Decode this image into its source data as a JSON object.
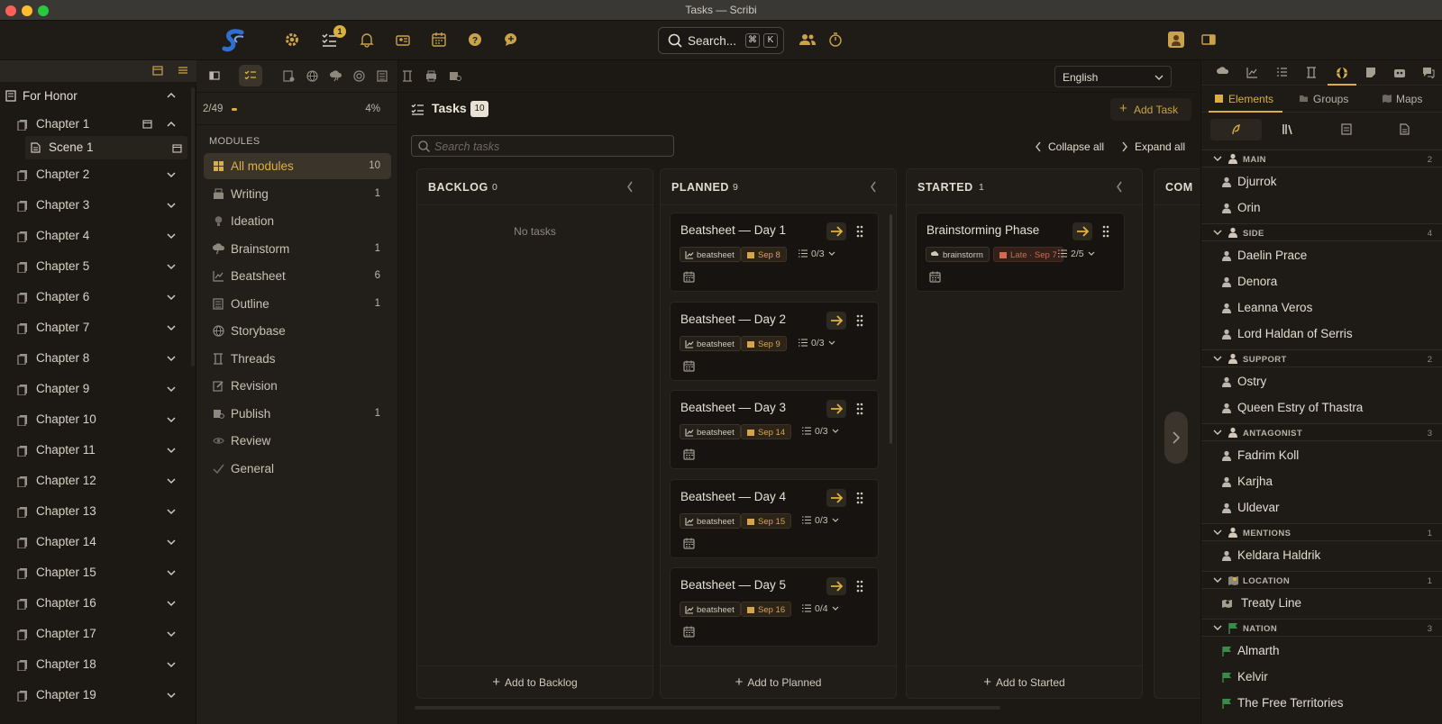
{
  "window": {
    "title": "Tasks — Scribi"
  },
  "toolbar": {
    "icons": [
      "gear-icon",
      "tasks-icon",
      "bell-icon",
      "people-card-icon",
      "calendar-icon",
      "help-icon",
      "chat-icon",
      "users-icon",
      "timer-icon",
      "avatar-icon",
      "panel-icon"
    ],
    "tasks_badge": "1",
    "search_label": "Search...",
    "search_kbd_1": "⌘",
    "search_kbd_2": "K",
    "accent": "#c9a24a"
  },
  "project": {
    "title": "For Honor",
    "chapters": [
      "Chapter 1",
      "Chapter 2",
      "Chapter 3",
      "Chapter 4",
      "Chapter 5",
      "Chapter 6",
      "Chapter 7",
      "Chapter 8",
      "Chapter 9",
      "Chapter 10",
      "Chapter 11",
      "Chapter 12",
      "Chapter 13",
      "Chapter 14",
      "Chapter 15",
      "Chapter 16",
      "Chapter 17",
      "Chapter 18",
      "Chapter 19"
    ],
    "scene": "Scene 1"
  },
  "progress": {
    "count": "2/49",
    "percent": "4%",
    "fraction": 0.04
  },
  "modules": {
    "heading": "MODULES",
    "items": [
      {
        "label": "All modules",
        "count": "10",
        "icon": "grid-icon"
      },
      {
        "label": "Writing",
        "count": "1",
        "icon": "typewriter-icon"
      },
      {
        "label": "Ideation",
        "count": "",
        "icon": "bulb-icon"
      },
      {
        "label": "Brainstorm",
        "count": "1",
        "icon": "cloud-bolt-icon"
      },
      {
        "label": "Beatsheet",
        "count": "6",
        "icon": "chart-icon"
      },
      {
        "label": "Outline",
        "count": "1",
        "icon": "list-icon"
      },
      {
        "label": "Storybase",
        "count": "",
        "icon": "globe-icon"
      },
      {
        "label": "Threads",
        "count": "",
        "icon": "threads-icon"
      },
      {
        "label": "Revision",
        "count": "",
        "icon": "edit-icon"
      },
      {
        "label": "Publish",
        "count": "1",
        "icon": "publish-icon"
      },
      {
        "label": "Review",
        "count": "",
        "icon": "eye-icon"
      },
      {
        "label": "General",
        "count": "",
        "icon": "check-icon"
      }
    ]
  },
  "board": {
    "title": "Tasks",
    "count": "10",
    "add_task": "Add Task",
    "search_placeholder": "Search tasks",
    "collapse_all": "Collapse all",
    "expand_all": "Expand all",
    "language": "English",
    "columns": [
      {
        "name": "BACKLOG",
        "count": "0",
        "empty": "No tasks",
        "add": "Add to Backlog",
        "cards": []
      },
      {
        "name": "PLANNED",
        "count": "9",
        "add": "Add to Planned",
        "cards": [
          {
            "title": "Beatsheet — Day 1",
            "module": "beatsheet",
            "date": "Sep 8",
            "sub": "0/3",
            "late": false
          },
          {
            "title": "Beatsheet — Day 2",
            "module": "beatsheet",
            "date": "Sep 9",
            "sub": "0/3",
            "late": false
          },
          {
            "title": "Beatsheet — Day 3",
            "module": "beatsheet",
            "date": "Sep 14",
            "sub": "0/3",
            "late": false
          },
          {
            "title": "Beatsheet — Day 4",
            "module": "beatsheet",
            "date": "Sep 15",
            "sub": "0/3",
            "late": false
          },
          {
            "title": "Beatsheet — Day 5",
            "module": "beatsheet",
            "date": "Sep 16",
            "sub": "0/4",
            "late": false
          }
        ]
      },
      {
        "name": "STARTED",
        "count": "1",
        "add": "Add to Started",
        "cards": [
          {
            "title": "Brainstorming Phase",
            "module": "brainstorm",
            "date": "Late · Sep 7",
            "sub": "2/5",
            "late": true
          }
        ]
      },
      {
        "name": "COM",
        "count": "",
        "add": "",
        "cards": []
      }
    ]
  },
  "rightpanel": {
    "tabs": [
      "Elements",
      "Groups",
      "Maps"
    ],
    "groups": [
      {
        "name": "MAIN",
        "count": "2",
        "kind": "person",
        "items": [
          "Djurrok",
          "Orin"
        ]
      },
      {
        "name": "SIDE",
        "count": "4",
        "kind": "person",
        "items": [
          "Daelin Prace",
          "Denora",
          "Leanna Veros",
          "Lord Haldan of Serris"
        ]
      },
      {
        "name": "SUPPORT",
        "count": "2",
        "kind": "person",
        "items": [
          "Ostry",
          "Queen Estry of Thastra"
        ]
      },
      {
        "name": "ANTAGONIST",
        "count": "3",
        "kind": "person",
        "items": [
          "Fadrim Koll",
          "Karjha",
          "Uldevar"
        ]
      },
      {
        "name": "MENTIONS",
        "count": "1",
        "kind": "person",
        "items": [
          "Keldara Haldrik"
        ]
      },
      {
        "name": "LOCATION",
        "count": "1",
        "kind": "map",
        "items": [
          "Treaty Line"
        ]
      },
      {
        "name": "NATION",
        "count": "3",
        "kind": "flag",
        "items": [
          "Almarth",
          "Kelvir",
          "The Free Territories"
        ]
      }
    ]
  }
}
